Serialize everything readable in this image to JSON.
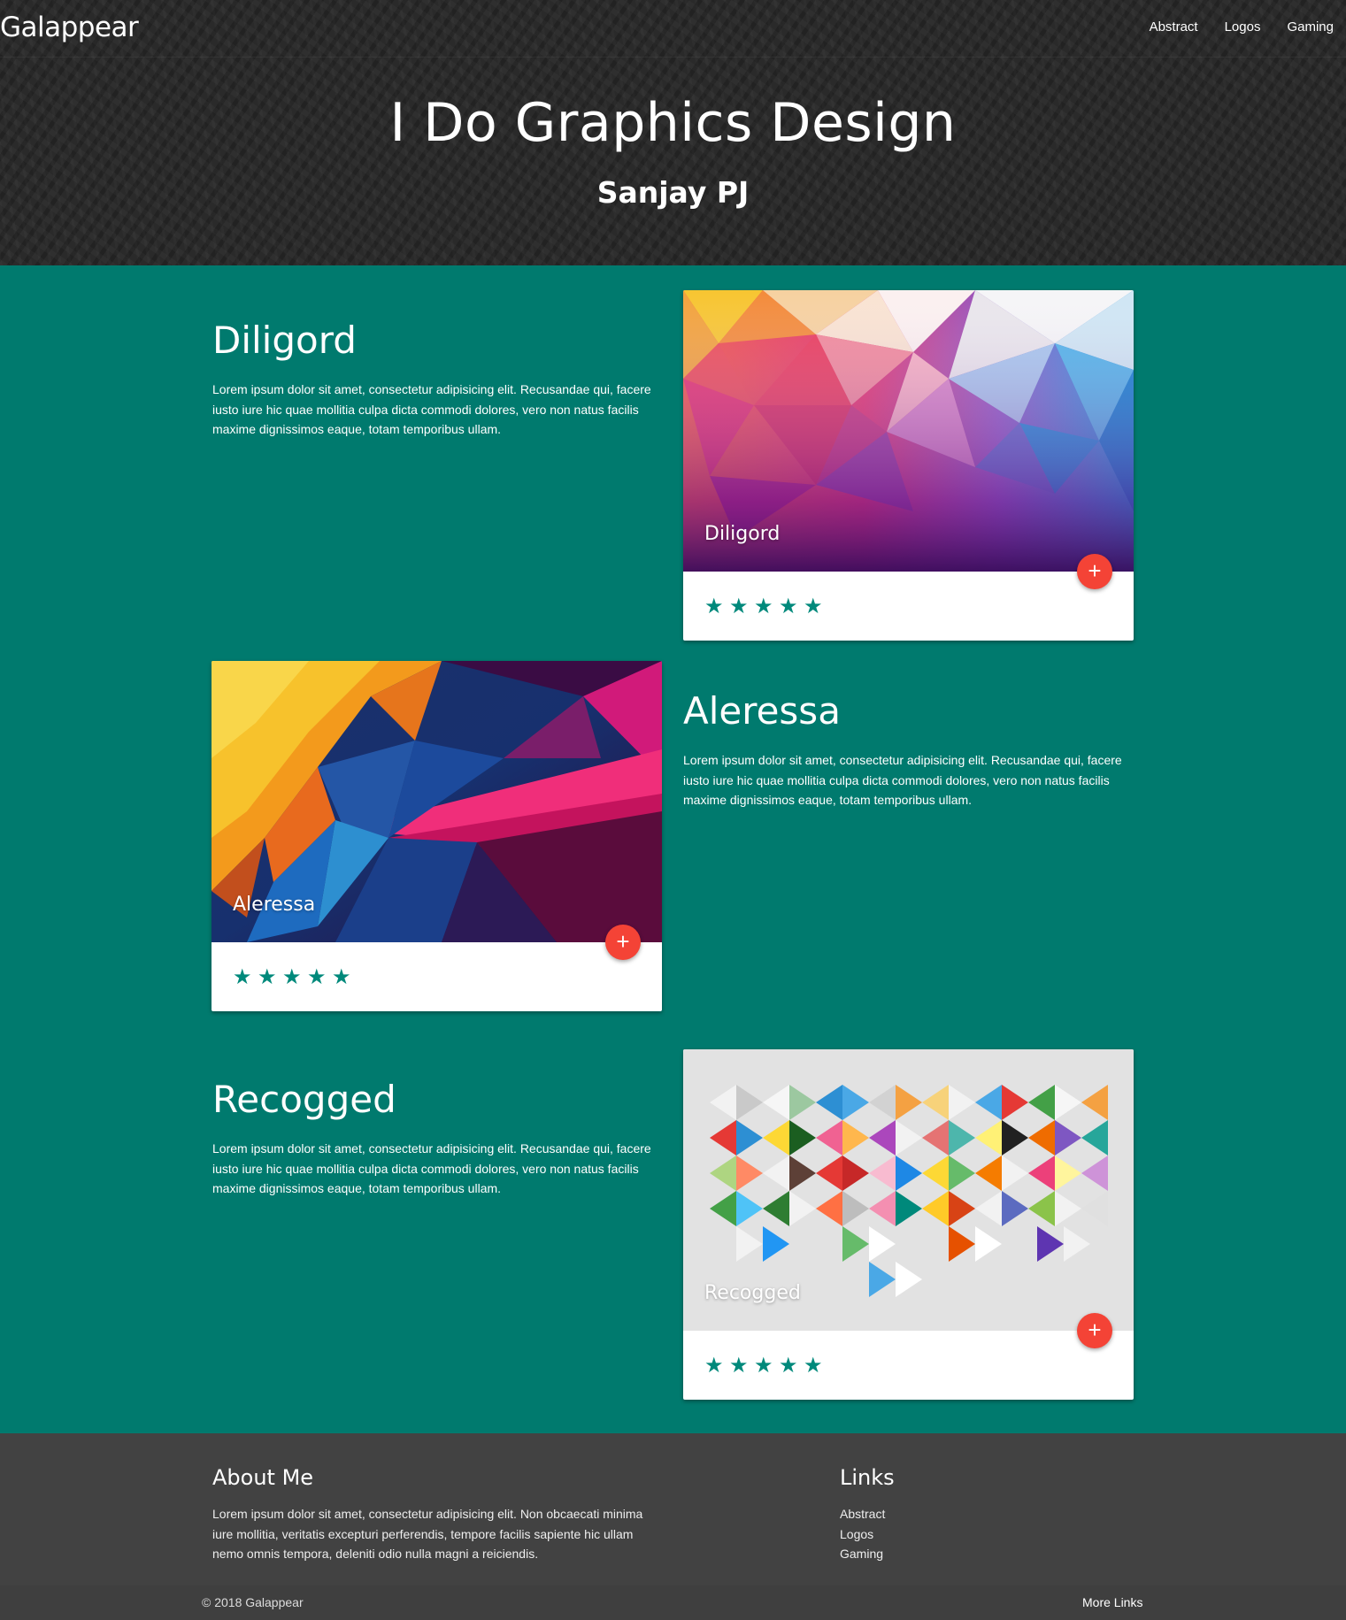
{
  "nav": {
    "brand": "Galappear",
    "links": [
      "Abstract",
      "Logos",
      "Gaming"
    ]
  },
  "hero": {
    "title": "I Do Graphics Design",
    "subtitle": "Sanjay PJ"
  },
  "projects": [
    {
      "name": "Diligord",
      "description": "Lorem ipsum dolor sit amet, consectetur adipisicing elit. Recusandae qui, facere iusto iure hic quae mollitia culpa dicta commodi dolores, vero non natus facilis maxime dignissimos eaque, totam temporibus ullam.",
      "card_title": "Diligord",
      "rating": 5,
      "action_icon": "plus-icon"
    },
    {
      "name": "Aleressa",
      "description": "Lorem ipsum dolor sit amet, consectetur adipisicing elit. Recusandae qui, facere iusto iure hic quae mollitia culpa dicta commodi dolores, vero non natus facilis maxime dignissimos eaque, totam temporibus ullam.",
      "card_title": "Aleressa",
      "rating": 5,
      "action_icon": "plus-icon"
    },
    {
      "name": "Recogged",
      "description": "Lorem ipsum dolor sit amet, consectetur adipisicing elit. Recusandae qui, facere iusto iure hic quae mollitia culpa dicta commodi dolores, vero non natus facilis maxime dignissimos eaque, totam temporibus ullam.",
      "card_title": "Recogged",
      "rating": 5,
      "action_icon": "plus-icon"
    }
  ],
  "footer": {
    "about_title": "About Me",
    "about_text": "Lorem ipsum dolor sit amet, consectetur adipisicing elit. Non obcaecati minima iure mollitia, veritatis excepturi perferendis, tempore facilis sapiente hic ullam nemo omnis tempora, deleniti odio nulla magni a reiciendis.",
    "links_title": "Links",
    "links": [
      "Abstract",
      "Logos",
      "Gaming"
    ],
    "copyright": "© 2018 Galappear",
    "more_links": "More Links"
  },
  "colors": {
    "page_background": "#007a6e",
    "header_background": "#2a2a2a",
    "footer_background": "#424242",
    "accent_star": "#00897b",
    "fab": "#f44336"
  },
  "icons": {
    "plus": "plus-icon",
    "star": "star-icon"
  }
}
